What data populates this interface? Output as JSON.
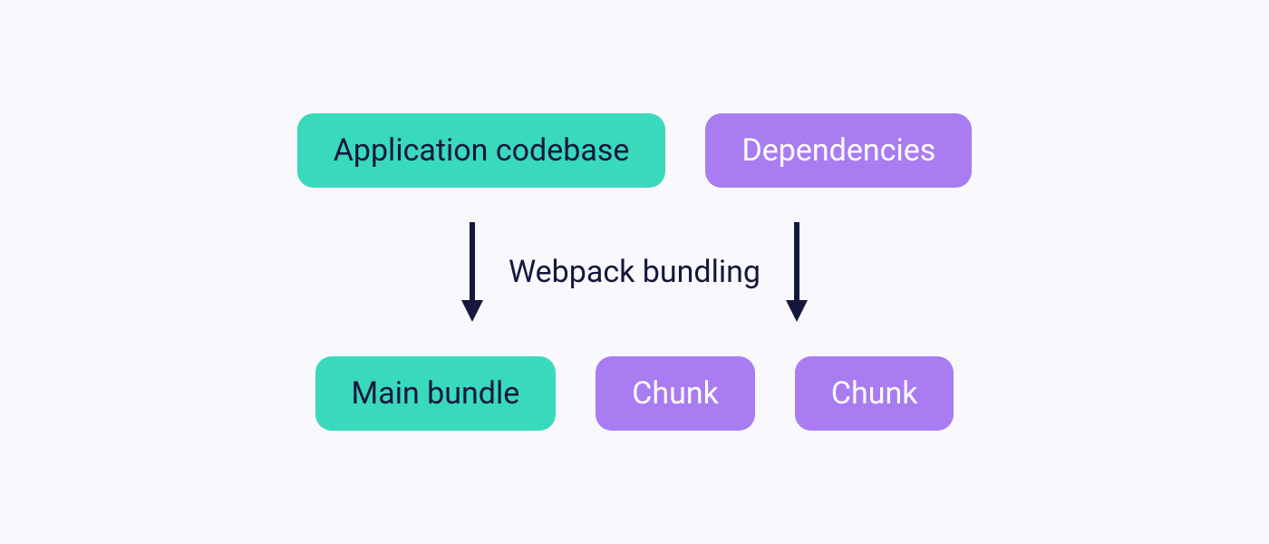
{
  "colors": {
    "teal": "#39d9bb",
    "purple": "#a97cf2",
    "dark": "#15173c",
    "background": "#f9f8fc"
  },
  "sources": {
    "app_codebase": "Application codebase",
    "dependencies": "Dependencies"
  },
  "process": {
    "label": "Webpack bundling"
  },
  "outputs": {
    "main_bundle": "Main bundle",
    "chunk1": "Chunk",
    "chunk2": "Chunk"
  }
}
